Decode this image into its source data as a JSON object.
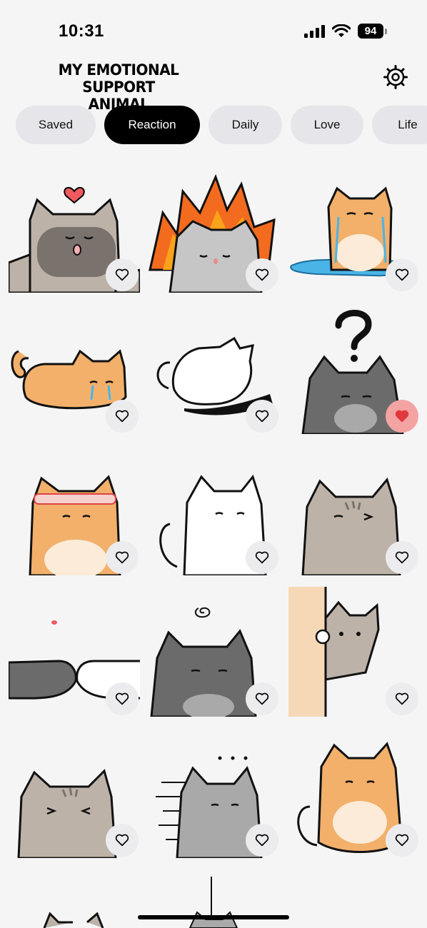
{
  "status": {
    "time": "10:31",
    "battery": "94"
  },
  "header": {
    "title_line1": "MY EMOTIONAL",
    "title_line2": "SUPPORT ANIMAL"
  },
  "tabs": [
    {
      "label": "Saved",
      "active": false
    },
    {
      "label": "Reaction",
      "active": true
    },
    {
      "label": "Daily",
      "active": false
    },
    {
      "label": "Love",
      "active": false
    },
    {
      "label": "Life",
      "active": false
    }
  ],
  "stickers": [
    {
      "name": "tabby-kiss",
      "liked": false
    },
    {
      "name": "white-fire",
      "liked": false
    },
    {
      "name": "orange-crying-puddle",
      "liked": false
    },
    {
      "name": "orange-lying-crying",
      "liked": false
    },
    {
      "name": "white-rolling",
      "liked": false
    },
    {
      "name": "gray-question",
      "liked": true
    },
    {
      "name": "orange-headband",
      "liked": false
    },
    {
      "name": "white-shy",
      "liked": false
    },
    {
      "name": "tabby-wink",
      "liked": false
    },
    {
      "name": "gray-hands-meet",
      "liked": false
    },
    {
      "name": "gray-dizzy",
      "liked": false
    },
    {
      "name": "tabby-peek-door",
      "liked": false
    },
    {
      "name": "tabby-squint",
      "liked": false
    },
    {
      "name": "gray-speed-dots",
      "liked": false
    },
    {
      "name": "orange-covering-mouth",
      "liked": false
    }
  ],
  "colors": {
    "tab_active": "#000000",
    "tab_inactive": "#e6e6ea",
    "liked": "#e0393e",
    "liked_bg": "#f4a3a3"
  }
}
